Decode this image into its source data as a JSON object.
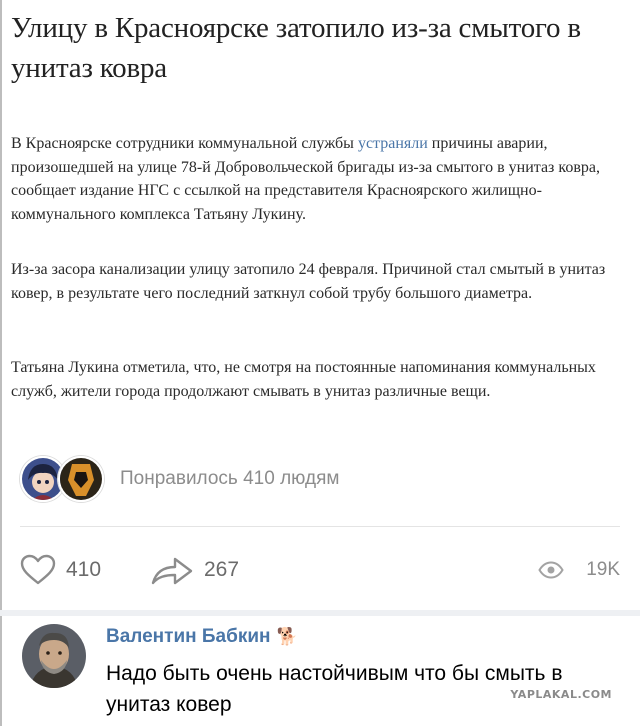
{
  "article": {
    "title": "Улицу в Красноярске затопило из-за смытого в унитаз ковра",
    "p1_before": "В Красноярске сотрудники коммунальной службы ",
    "p1_link": "устраняли",
    "p1_after": " причины аварии, произошедшей на улице 78-й Добровольческой бригады из-за смытого в унитаз ковра, сообщает издание НГС с ссылкой на представителя Красноярского жилищно-коммунального комплекса Татьяну Лукину.",
    "p2": "Из-за засора канализации улицу затопило 24 февраля. Причиной стал смытый в унитаз ковер, в результате чего последний заткнул собой трубу большого диаметра.",
    "p3": "Татьяна Лукина отметила, что, не смотря на постоянные напоминания коммунальных служб, жители города продолжают смывать в унитаз различные вещи."
  },
  "likes_summary": {
    "text": "Понравилось 410 людям",
    "avatars": [
      "avatar-1",
      "avatar-2"
    ]
  },
  "actions": {
    "likes": "410",
    "shares": "267",
    "views": "19K",
    "icons": [
      "heart-icon",
      "share-icon",
      "eye-icon"
    ]
  },
  "comment": {
    "author": "Валентин Бабкин",
    "author_emoji": "🐕",
    "text": "Надо быть очень настойчивым что бы смыть в унитаз ковер"
  },
  "watermark": "YAPLAKAL.COM",
  "colors": {
    "link": "#4a76a8",
    "muted": "#8c8c8c",
    "separator": "#eef0f3"
  }
}
